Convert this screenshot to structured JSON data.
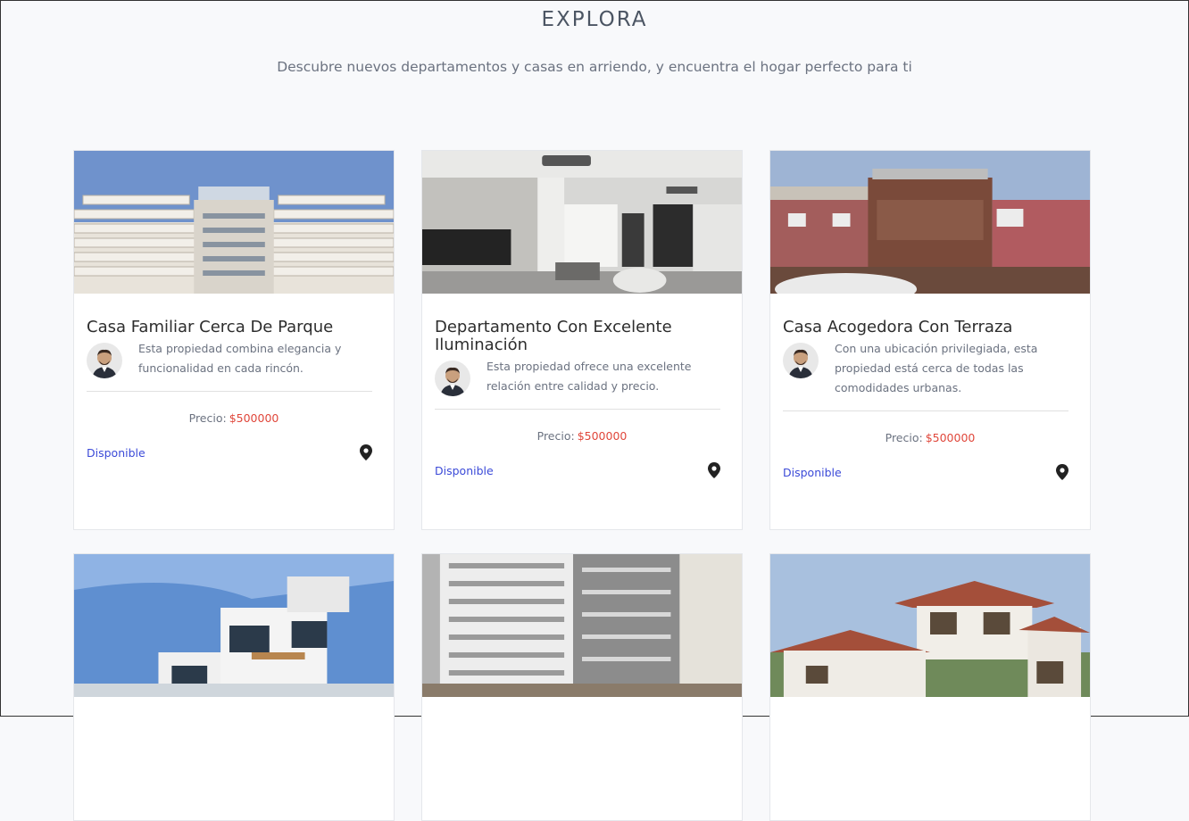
{
  "header": {
    "title": "EXPLORA",
    "subtitle": "Descubre nuevos departamentos y casas en arriendo, y encuentra el hogar perfecto para ti"
  },
  "colors": {
    "price": "#e0473b",
    "status": "#3b4ad8",
    "background": "#f8f9fb"
  },
  "cards": [
    {
      "title": "Casa Familiar Cerca De Parque",
      "description": "Esta propiedad combina elegancia y funcionalidad en cada rincón.",
      "price_label": "Precio:",
      "price": "$500000",
      "status": "Disponible",
      "icon": "map-pin-icon",
      "image": "modern-apartment-building"
    },
    {
      "title": "Departamento Con Excelente Iluminación",
      "description": "Esta propiedad ofrece una excelente relación entre calidad y precio.",
      "price_label": "Precio:",
      "price": "$500000",
      "status": "Disponible",
      "icon": "map-pin-icon",
      "image": "bright-interior-living-room"
    },
    {
      "title": "Casa Acogedora Con Terraza",
      "description": "Con una ubicación privilegiada, esta propiedad está cerca de todas las comodidades urbanas.",
      "price_label": "Precio:",
      "price": "$500000",
      "status": "Disponible",
      "icon": "map-pin-icon",
      "image": "house-with-terrace"
    },
    {
      "image": "modern-villa"
    },
    {
      "image": "apartment-tower"
    },
    {
      "image": "two-story-house"
    }
  ]
}
